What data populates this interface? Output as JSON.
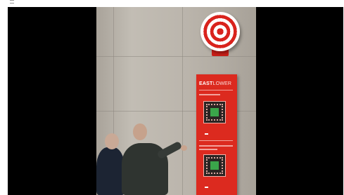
{
  "photo": {
    "subject": "stadium-wayfinding-sign",
    "sign": {
      "title_bold": "EAST",
      "title_light": "LOWER",
      "background_color": "#dc2a1f",
      "pitch_color": "#3aa54a",
      "target_colors": [
        "#d9231d",
        "#ffffff"
      ]
    }
  }
}
